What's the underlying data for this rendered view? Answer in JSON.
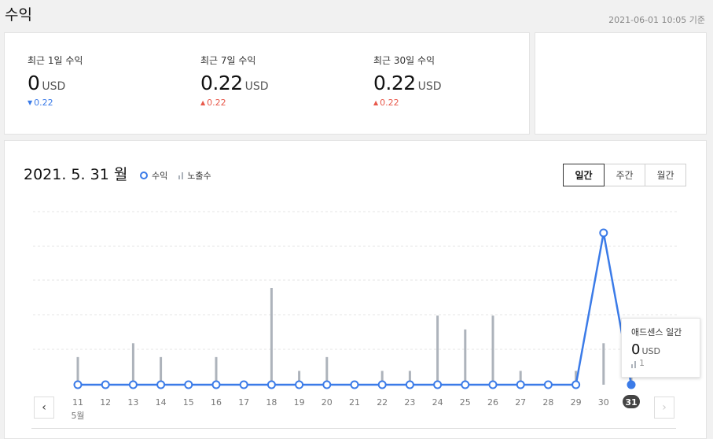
{
  "page": {
    "title": "수익",
    "as_of": "2021-06-01 10:05 기준"
  },
  "summary": [
    {
      "label": "최근 1일 수익",
      "value": "0",
      "unit": "USD",
      "delta": "0.22",
      "direction": "down"
    },
    {
      "label": "최근 7일 수익",
      "value": "0.22",
      "unit": "USD",
      "delta": "0.22",
      "direction": "up"
    },
    {
      "label": "최근 30일 수익",
      "value": "0.22",
      "unit": "USD",
      "delta": "0.22",
      "direction": "up"
    }
  ],
  "colors": {
    "revenue": "#3b7be8",
    "impressions": "#adb3bb",
    "up": "#e8594b",
    "down": "#3b7be8"
  },
  "chart": {
    "title": "2021. 5. 31 월",
    "legend": {
      "revenue": "수익",
      "impressions": "노출수"
    },
    "tabs": [
      "일간",
      "주간",
      "월간"
    ],
    "active_tab": "일간",
    "month_label": "5월",
    "tooltip": {
      "title": "애드센스 일간",
      "value": "0",
      "unit": "USD",
      "impressions": "1"
    }
  },
  "chart_data": {
    "type": "line",
    "categories": [
      "11",
      "12",
      "13",
      "14",
      "15",
      "16",
      "17",
      "18",
      "19",
      "20",
      "21",
      "22",
      "23",
      "24",
      "25",
      "26",
      "27",
      "28",
      "29",
      "30",
      "31"
    ],
    "series": [
      {
        "name": "수익",
        "kind": "line",
        "values": [
          0,
          0,
          0,
          0,
          0,
          0,
          0,
          0,
          0,
          0,
          0,
          0,
          0,
          0,
          0,
          0,
          0,
          0,
          0,
          0.22,
          0
        ]
      },
      {
        "name": "노출수",
        "kind": "bar",
        "values": [
          2,
          0,
          3,
          2,
          0,
          2,
          0,
          7,
          1,
          2,
          0,
          1,
          1,
          5,
          4,
          5,
          1,
          0,
          1,
          3,
          1
        ]
      }
    ],
    "selected_category": "31",
    "grid": true,
    "legend_position": "top-left"
  }
}
